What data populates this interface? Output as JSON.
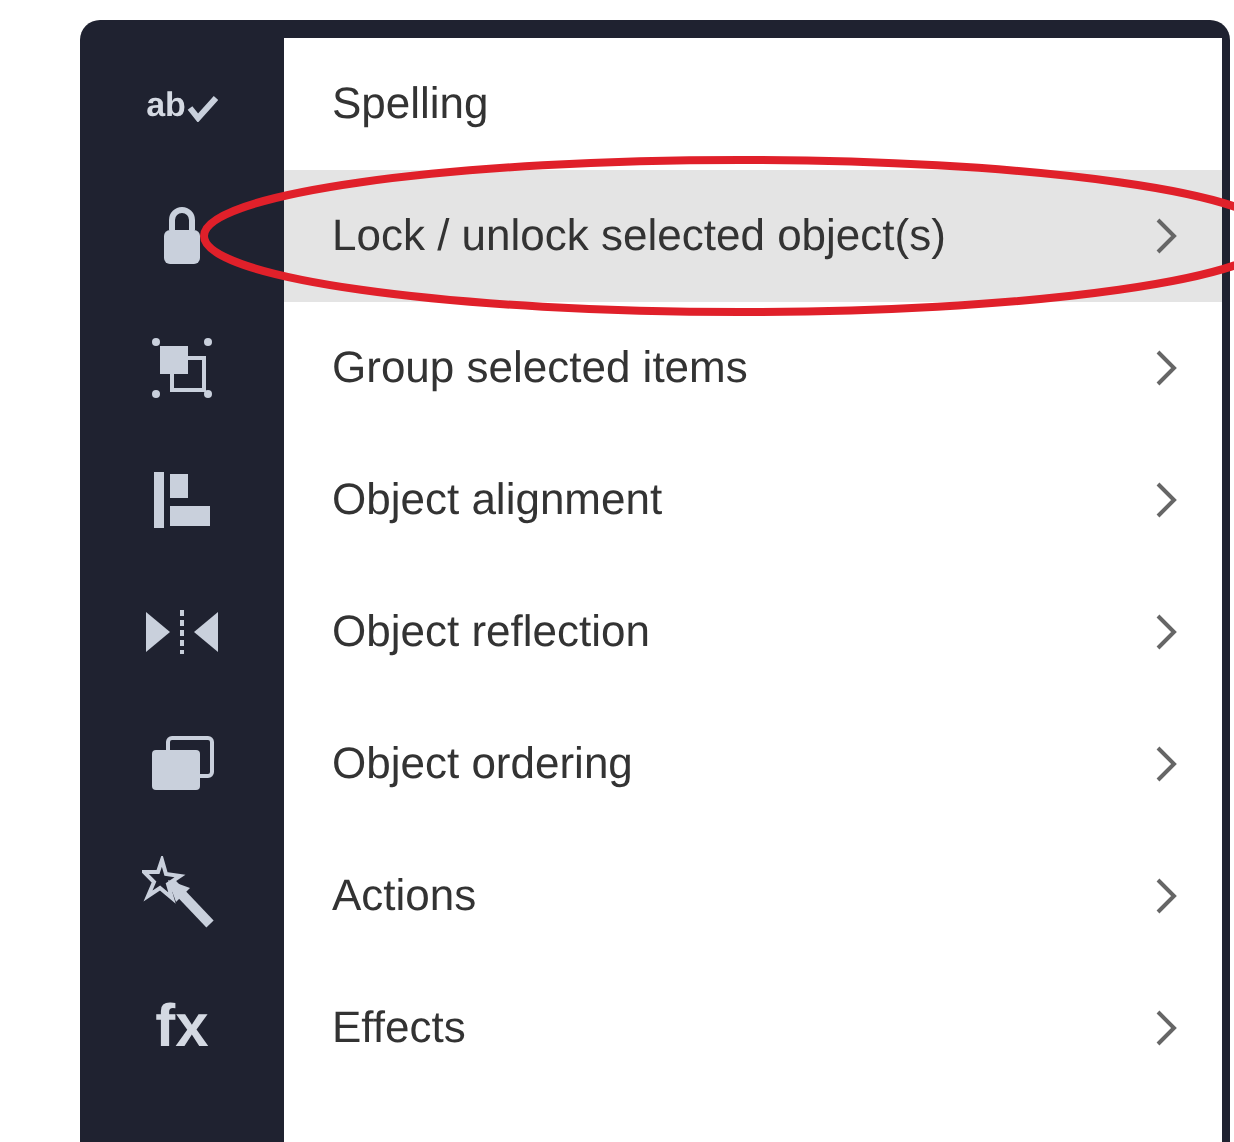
{
  "menu": {
    "items": [
      {
        "label": "Spelling",
        "icon_text": "ab",
        "submenu": false,
        "selected": false,
        "circled": false
      },
      {
        "label": "Lock / unlock selected object(s)",
        "submenu": true,
        "selected": true,
        "circled": true
      },
      {
        "label": "Group selected items",
        "submenu": true,
        "selected": false,
        "circled": false
      },
      {
        "label": "Object alignment",
        "submenu": true,
        "selected": false,
        "circled": false
      },
      {
        "label": "Object reflection",
        "submenu": true,
        "selected": false,
        "circled": false
      },
      {
        "label": "Object ordering",
        "submenu": true,
        "selected": false,
        "circled": false
      },
      {
        "label": "Actions",
        "submenu": true,
        "selected": false,
        "circled": false
      },
      {
        "label": "Effects",
        "icon_text": "fx",
        "submenu": true,
        "selected": false,
        "circled": false
      }
    ]
  }
}
